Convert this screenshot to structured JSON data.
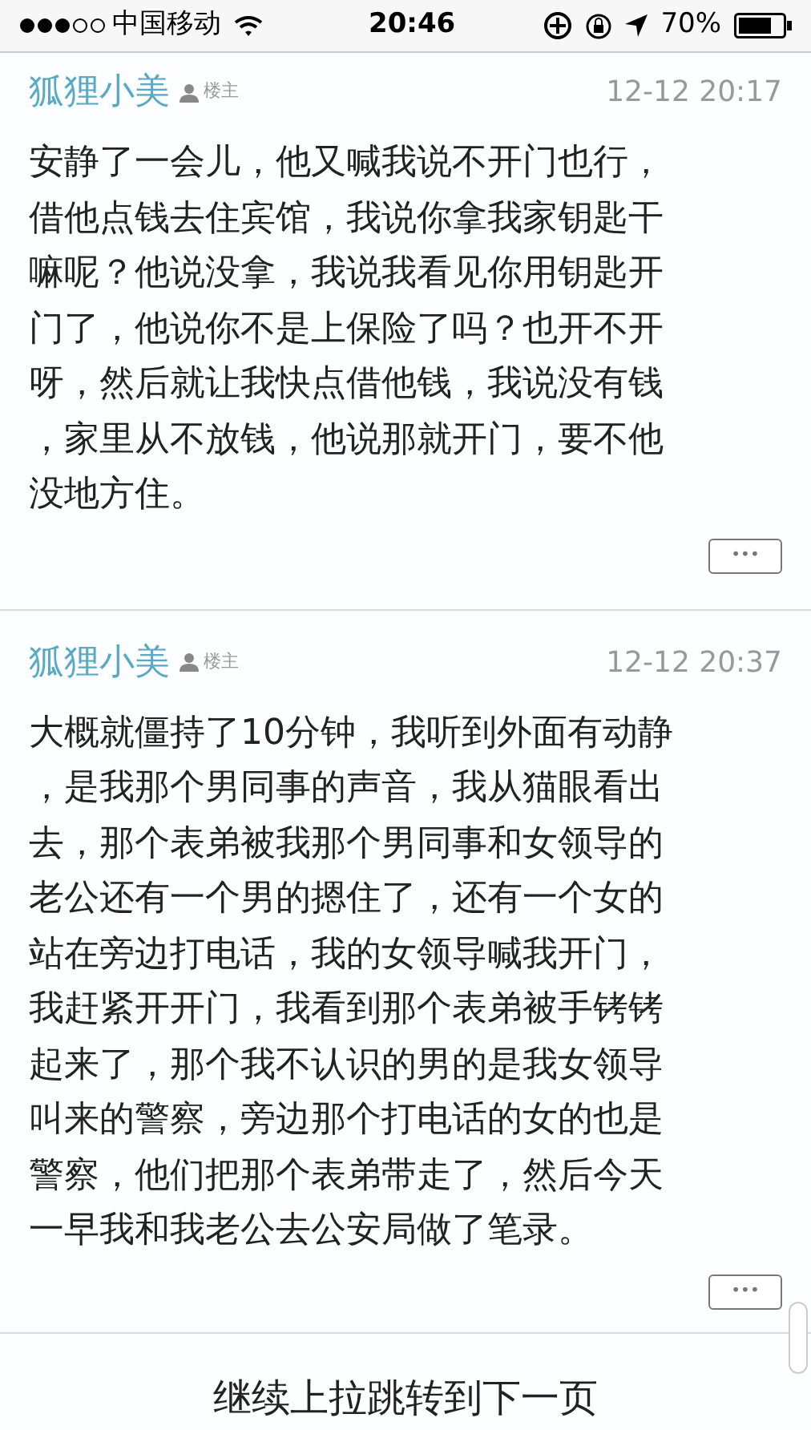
{
  "status_bar": {
    "carrier": "中国移动",
    "time": "20:46",
    "battery": "70%"
  },
  "posts": [
    {
      "author": "狐狸小美",
      "badge": "楼主",
      "time": "12-12 20:17",
      "lines": [
        "安静了一会儿，他又喊我说不开门也行，",
        "借他点钱去住宾馆，我说你拿我家钥匙干",
        "嘛呢？他说没拿，我说我看见你用钥匙开",
        "门了，他说你不是上保险了吗？也开不开",
        "呀，然后就让我快点借他钱，我说没有钱",
        "，家里从不放钱，他说那就开门，要不他",
        "没地方住。"
      ],
      "more": "•••"
    },
    {
      "author": "狐狸小美",
      "badge": "楼主",
      "time": "12-12 20:37",
      "lines": [
        "大概就僵持了10分钟，我听到外面有动静",
        "，是我那个男同事的声音，我从猫眼看出",
        "去，那个表弟被我那个男同事和女领导的",
        "老公还有一个男的摁住了，还有一个女的",
        "站在旁边打电话，我的女领导喊我开门，",
        "我赶紧开开门，我看到那个表弟被手铐铐",
        "起来了，那个我不认识的男的是我女领导",
        "叫来的警察，旁边那个打电话的女的也是",
        "警察，他们把那个表弟带走了，然后今天",
        "一早我和我老公去公安局做了笔录。"
      ],
      "more": "•••"
    }
  ],
  "footer": "继续上拉跳转到下一页"
}
